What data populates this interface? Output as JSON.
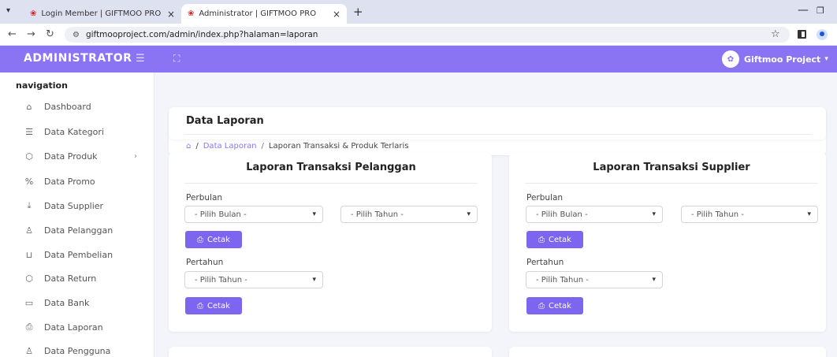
{
  "browser": {
    "tabs": [
      {
        "title": "Login Member | GIFTMOO PRO",
        "close": "×"
      },
      {
        "title": "Administrator | GIFTMOO PRO",
        "close": "×"
      }
    ],
    "new_tab": "+",
    "url": "giftmooproject.com/admin/index.php?halaman=laporan"
  },
  "header": {
    "brand": "ADMINISTRATOR",
    "user_name": "Giftmoo Project"
  },
  "sidebar": {
    "heading": "navigation",
    "items": [
      {
        "label": "Dashboard",
        "icon": "home-icon"
      },
      {
        "label": "Data Kategori",
        "icon": "list-icon"
      },
      {
        "label": "Data Produk",
        "icon": "box-icon"
      },
      {
        "label": "Data Promo",
        "icon": "percent-icon"
      },
      {
        "label": "Data Supplier",
        "icon": "download-icon"
      },
      {
        "label": "Data Pelanggan",
        "icon": "users-icon"
      },
      {
        "label": "Data Pembelian",
        "icon": "cart-icon"
      },
      {
        "label": "Data Return",
        "icon": "box-icon"
      },
      {
        "label": "Data Bank",
        "icon": "card-icon"
      },
      {
        "label": "Data Laporan",
        "icon": "printer-icon"
      },
      {
        "label": "Data Pengguna",
        "icon": "user-icon"
      }
    ]
  },
  "page": {
    "title": "Data Laporan",
    "breadcrumb": {
      "link": "Data Laporan",
      "current": "Laporan Transaksi & Produk Terlaris",
      "separator": "/"
    }
  },
  "panels": [
    {
      "title": "Laporan Transaksi Pelanggan",
      "monthly_label": "Perbulan",
      "month_select": "- Pilih Bulan -",
      "year_select": "- Pilih Tahun -",
      "print_button": "Cetak",
      "yearly_label": "Pertahun",
      "yearly_select": "- Pilih Tahun -",
      "print_button_2": "Cetak"
    },
    {
      "title": "Laporan Transaksi Supplier",
      "monthly_label": "Perbulan",
      "month_select": "- Pilih Bulan -",
      "year_select": "- Pilih Tahun -",
      "print_button": "Cetak",
      "yearly_label": "Pertahun",
      "yearly_select": "- Pilih Tahun -",
      "print_button_2": "Cetak"
    }
  ],
  "colors": {
    "accent": "#8b74f3",
    "button": "#7d65f0"
  }
}
